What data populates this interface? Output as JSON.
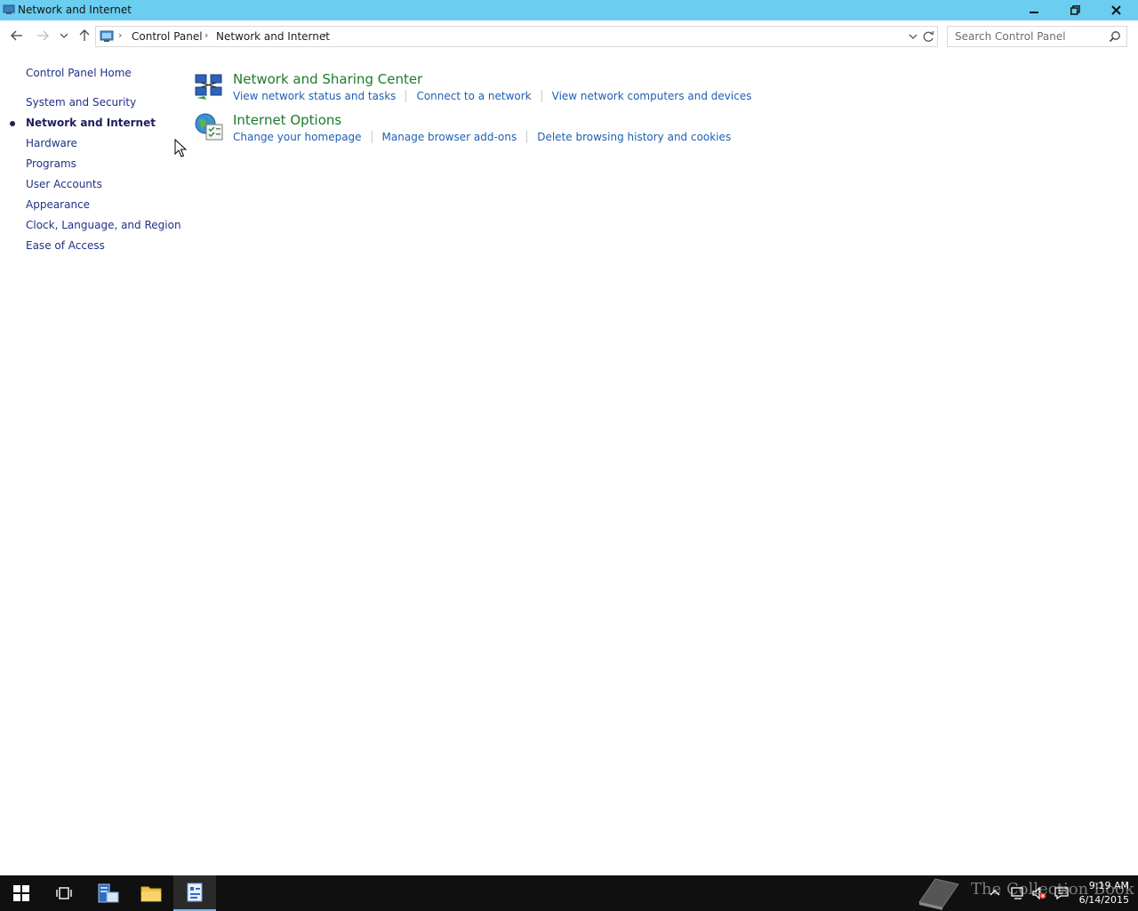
{
  "window": {
    "title": "Network and Internet",
    "controls": {
      "minimize": "minimize",
      "restore": "restore",
      "close": "close"
    }
  },
  "nav": {
    "breadcrumb": [
      "Control Panel",
      "Network and Internet"
    ],
    "search_placeholder": "Search Control Panel"
  },
  "sidebar": {
    "items": [
      {
        "label": "Control Panel Home",
        "active": false
      },
      {
        "label": "System and Security",
        "active": false
      },
      {
        "label": "Network and Internet",
        "active": true
      },
      {
        "label": "Hardware",
        "active": false
      },
      {
        "label": "Programs",
        "active": false
      },
      {
        "label": "User Accounts",
        "active": false
      },
      {
        "label": "Appearance",
        "active": false
      },
      {
        "label": "Clock, Language, and Region",
        "active": false
      },
      {
        "label": "Ease of Access",
        "active": false
      }
    ]
  },
  "main": {
    "categories": [
      {
        "title": "Network and Sharing Center",
        "icon": "network-sharing-icon",
        "links": [
          "View network status and tasks",
          "Connect to a network",
          "View network computers and devices"
        ]
      },
      {
        "title": "Internet Options",
        "icon": "internet-options-icon",
        "links": [
          "Change your homepage",
          "Manage browser add-ons",
          "Delete browsing history and cookies"
        ]
      }
    ]
  },
  "taskbar": {
    "watermark": "The Collection Book",
    "time": "9:19 AM",
    "date": "6/14/2015"
  },
  "colors": {
    "titlebar": "#6bcdf0",
    "link": "#1e5fb4",
    "category_title": "#1e7a2a",
    "taskbar": "#101010"
  }
}
